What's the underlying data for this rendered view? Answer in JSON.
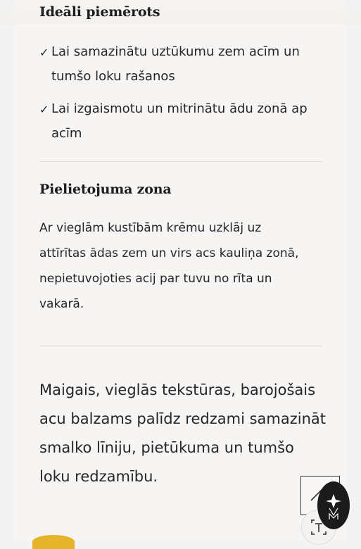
{
  "ideal_section": {
    "heading": "Ideāli piemērots",
    "checkmark": "✓",
    "items": [
      {
        "line1": "Lai samazinātu uztūkumu zem acīm un",
        "line2": "tumšo loku rašanos"
      },
      {
        "line1": "Lai izgaismotu un mitrinātu ādu zonā ap",
        "line2": "acīm"
      }
    ]
  },
  "usage_section": {
    "heading": "Pielietojuma zona",
    "lines": [
      "Ar vieglām kustībām krēmu uzklāj uz",
      "attīrītas ādas zem un virs acs kauliņa zonā,",
      "nepietuvojoties acij par tuvu no rīta un",
      "vakarā."
    ]
  },
  "description": {
    "lines": [
      "Maigais, vieglās tekstūras, barojošais",
      "acu balzams palīdz redzami samazināt",
      "smalko līniju, pietūkuma un tumšo",
      "loku redzamību."
    ]
  },
  "icons": {
    "edit": "pencil-icon",
    "text_scan": "text-scan-icon",
    "assistant": "sparkle-logo-icon"
  },
  "colors": {
    "page_bg": "#f3f3f3",
    "card_bg": "#f6f5f3",
    "text": "#262626",
    "accent_yellow": "#e5b42a",
    "fab_dark": "#1b1b1b"
  }
}
